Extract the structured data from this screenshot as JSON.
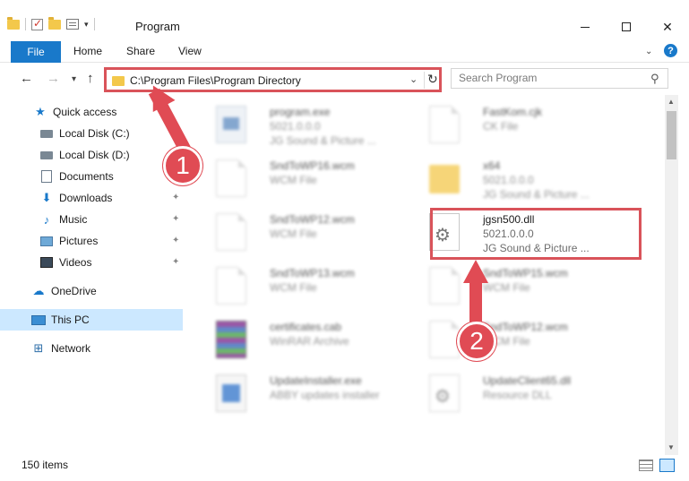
{
  "window": {
    "title": "Program"
  },
  "ribbon": {
    "tabs": [
      "File",
      "Home",
      "Share",
      "View"
    ],
    "help": "?"
  },
  "navigation": {
    "address": "C:\\Program Files\\Program Directory",
    "search_placeholder": "Search Program"
  },
  "sidebar": {
    "items": [
      {
        "label": "Quick access",
        "icon": "star-icon",
        "pinned": false
      },
      {
        "label": "Local Disk (C:)",
        "icon": "disk-icon",
        "pinned": true
      },
      {
        "label": "Local Disk (D:)",
        "icon": "disk-icon",
        "pinned": false
      },
      {
        "label": "Documents",
        "icon": "documents-icon",
        "pinned": true
      },
      {
        "label": "Downloads",
        "icon": "downloads-icon",
        "pinned": true
      },
      {
        "label": "Music",
        "icon": "music-icon",
        "pinned": true
      },
      {
        "label": "Pictures",
        "icon": "pictures-icon",
        "pinned": true
      },
      {
        "label": "Videos",
        "icon": "videos-icon",
        "pinned": true
      },
      {
        "label": "OneDrive",
        "icon": "cloud-icon",
        "pinned": false
      },
      {
        "label": "This PC",
        "icon": "pc-icon",
        "pinned": false,
        "selected": true
      },
      {
        "label": "Network",
        "icon": "network-icon",
        "pinned": false
      }
    ]
  },
  "files": [
    {
      "name": "program.exe",
      "meta1": "5021.0.0.0",
      "meta2": "JG Sound & Picture ...",
      "icon": "exe-icon"
    },
    {
      "name": "FastKom.cjk",
      "meta1": "CK File",
      "meta2": "",
      "icon": "file-icon"
    },
    {
      "name": "SndToWP16.wcm",
      "meta1": "WCM File",
      "meta2": "",
      "icon": "file-icon"
    },
    {
      "name": "x64",
      "meta1": "5021.0.0.0",
      "meta2": "JG Sound & Picture ...",
      "icon": "folder-icon"
    },
    {
      "name": "SndToWP12.wcm",
      "meta1": "WCM File",
      "meta2": "",
      "icon": "file-icon"
    },
    {
      "name": "jgsn500.dll",
      "meta1": "5021.0.0.0",
      "meta2": "JG Sound & Picture ...",
      "icon": "dll-gear-icon"
    },
    {
      "name": "SndToWP13.wcm",
      "meta1": "WCM File",
      "meta2": "",
      "icon": "file-icon"
    },
    {
      "name": "SndToWP15.wcm",
      "meta1": "WCM File",
      "meta2": "",
      "icon": "file-icon"
    },
    {
      "name": "certificates.cab",
      "meta1": "WinRAR Archive",
      "meta2": "",
      "icon": "archive-icon"
    },
    {
      "name": "SndToWP12.wcm",
      "meta1": "WCM File",
      "meta2": "",
      "icon": "file-icon"
    },
    {
      "name": "UpdateInstaller.exe",
      "meta1": "ABBY updates installer",
      "meta2": "",
      "icon": "installer-icon"
    },
    {
      "name": "UpdateClient65.dll",
      "meta1": "Resource DLL",
      "meta2": "",
      "icon": "dll-icon"
    }
  ],
  "status": {
    "item_count": "150 items"
  },
  "callouts": {
    "step1": "1",
    "step2": "2"
  },
  "colors": {
    "accent": "#1979ca",
    "highlight": "#d9535a",
    "selection": "#cce8ff"
  }
}
